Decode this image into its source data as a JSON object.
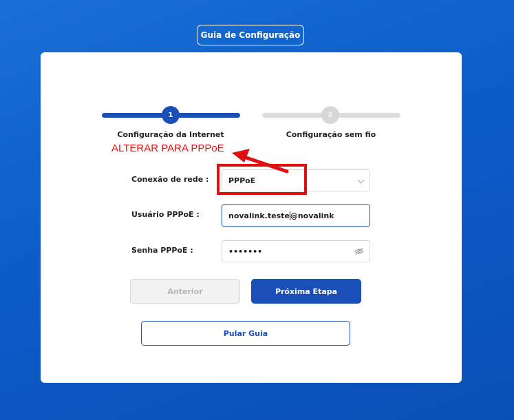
{
  "header": {
    "guide_title": "Guia de Configuração"
  },
  "steps": [
    {
      "number": "1",
      "label": "Configuração da Internet",
      "active": true
    },
    {
      "number": "2",
      "label": "Configuração sem fio",
      "active": false
    }
  ],
  "annotation": {
    "text": "ALTERAR PARA PPPoE",
    "color": "#e01010"
  },
  "form": {
    "connection_label": "Conexão de rede :",
    "connection_value": "PPPoE",
    "user_label": "Usuário PPPoE :",
    "user_value_before_caret": "novalink.teste",
    "user_value_after_caret": "@novalink",
    "password_label": "Senha PPPoE :",
    "password_value": "•••••••"
  },
  "buttons": {
    "previous": "Anterior",
    "next": "Próxima Etapa",
    "skip": "Pular Guia"
  },
  "colors": {
    "primary": "#1a4fb8",
    "background": "#0b5cc9",
    "annotation": "#e01010"
  }
}
